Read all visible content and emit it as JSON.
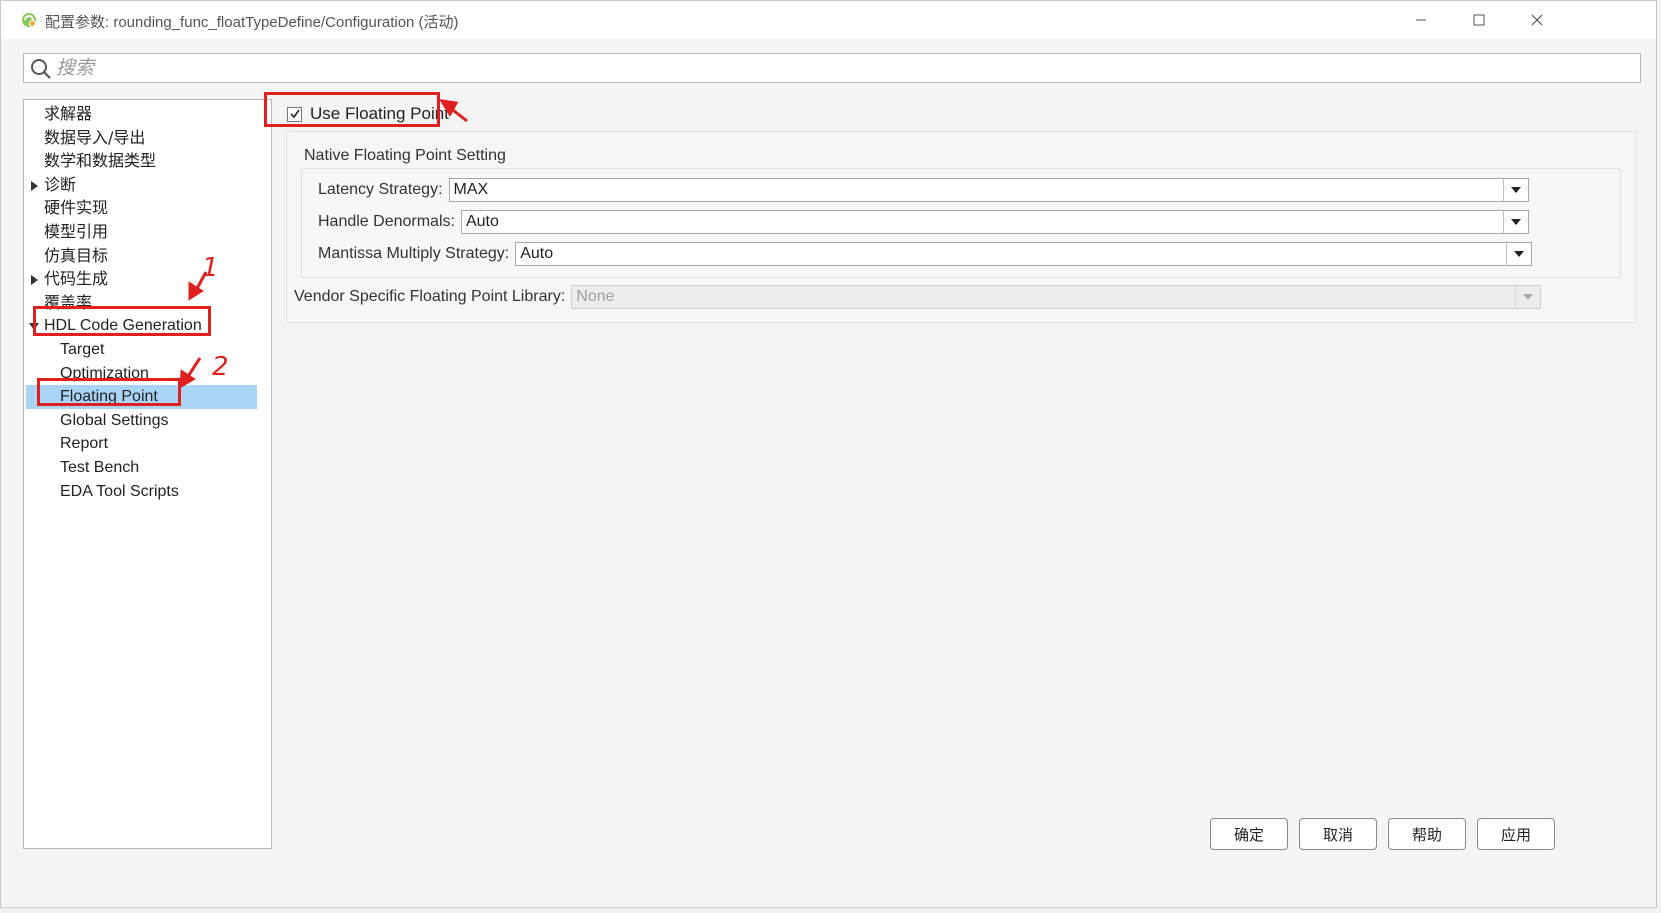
{
  "window": {
    "title": "配置参数: rounding_func_floatTypeDefine/Configuration (活动)"
  },
  "search": {
    "placeholder": "搜索"
  },
  "tree": {
    "items": [
      {
        "label": "求解器"
      },
      {
        "label": "数据导入/导出"
      },
      {
        "label": "数学和数据类型"
      },
      {
        "label": "诊断"
      },
      {
        "label": "硬件实现"
      },
      {
        "label": "模型引用"
      },
      {
        "label": "仿真目标"
      },
      {
        "label": "代码生成"
      },
      {
        "label": "覆盖率"
      },
      {
        "label": "HDL Code Generation"
      },
      {
        "label": "Target"
      },
      {
        "label": "Optimization"
      },
      {
        "label": "Floating Point"
      },
      {
        "label": "Global Settings"
      },
      {
        "label": "Report"
      },
      {
        "label": "Test Bench"
      },
      {
        "label": "EDA Tool Scripts"
      }
    ],
    "selected": "Floating Point"
  },
  "pane": {
    "use_floating_point": {
      "label": "Use Floating Point",
      "checked": true
    },
    "native_group": {
      "title": "Native Floating Point Setting",
      "latency": {
        "label": "Latency Strategy:",
        "value": "MAX"
      },
      "denormals": {
        "label": "Handle Denormals:",
        "value": "Auto"
      },
      "mantissa": {
        "label": "Mantissa Multiply Strategy:",
        "value": "Auto"
      }
    },
    "vendor": {
      "label": "Vendor Specific Floating Point Library:",
      "value": "None",
      "disabled": true
    }
  },
  "buttons": {
    "ok": "确定",
    "cancel": "取消",
    "help": "帮助",
    "apply": "应用"
  },
  "annotations": {
    "n1": "1",
    "n2": "2"
  },
  "colors": {
    "highlight": "#e02020",
    "selection": "#a9d4f6"
  }
}
